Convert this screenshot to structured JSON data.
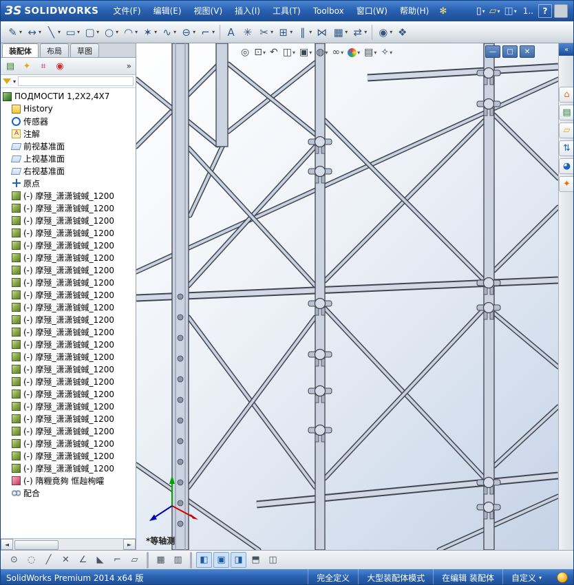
{
  "colors": {
    "titlebar_blue": "#2a62b2",
    "statusbar_blue": "#2a62b2",
    "toolbar_gray": "#dfe4ea",
    "pressed_blue": "#cde0f7",
    "scaffold_steel": "#ccd3e0",
    "viewport_bg_top": "#ffffff",
    "viewport_bg_bottom": "#c5d3e6"
  },
  "titlebar": {
    "logo_mark": "ЗS",
    "logo_text": "SOLIDWORKS",
    "menus": [
      {
        "label": "文件(F)"
      },
      {
        "label": "编辑(E)"
      },
      {
        "label": "视图(V)"
      },
      {
        "label": "插入(I)"
      },
      {
        "label": "工具(T)"
      },
      {
        "label": "Toolbox"
      },
      {
        "label": "窗口(W)"
      },
      {
        "label": "帮助(H)"
      }
    ],
    "sparkle": "✻",
    "quick_icons": [
      {
        "name": "new-document-icon",
        "g": "▯",
        "arrow": "▾"
      },
      {
        "name": "open-icon",
        "g": "▱",
        "arrow": "▾"
      },
      {
        "name": "save-icon",
        "g": "◫",
        "arrow": "▾"
      }
    ],
    "doc_title": "1..",
    "help_label": "?"
  },
  "toolbar": {
    "items": [
      {
        "name": "sketch-icon",
        "g": "✎",
        "arrow": "▾"
      },
      {
        "name": "smart-dimension-icon",
        "g": "↔",
        "arrow": "▾"
      },
      {
        "name": "line-icon",
        "g": "╲",
        "arrow": "▾"
      },
      {
        "name": "rectangle-icon",
        "g": "▭",
        "arrow": "▾"
      },
      {
        "name": "slot-icon",
        "g": "▢",
        "arrow": "▾"
      },
      {
        "name": "circle-icon",
        "g": "○",
        "arrow": "▾"
      },
      {
        "name": "arc-icon",
        "g": "◠",
        "arrow": "▾"
      },
      {
        "name": "polygon-icon",
        "g": "✶",
        "arrow": "▾"
      },
      {
        "name": "spline-icon",
        "g": "∿",
        "arrow": "▾"
      },
      {
        "name": "ellipse-icon",
        "g": "⊖",
        "arrow": "▾"
      },
      {
        "name": "fillet-icon",
        "g": "⌐",
        "arrow": "▾"
      },
      {
        "name": "separator",
        "kind": "sep"
      },
      {
        "name": "text-icon",
        "g": "A"
      },
      {
        "name": "point-icon",
        "g": "✳"
      },
      {
        "name": "trim-icon",
        "g": "✂",
        "arrow": "▾"
      },
      {
        "name": "convert-entities-icon",
        "g": "⊞",
        "arrow": "▾"
      },
      {
        "name": "offset-entities-icon",
        "g": "∥",
        "arrow": "▾"
      },
      {
        "name": "mirror-entities-icon",
        "g": "⋈"
      },
      {
        "name": "linear-pattern-icon",
        "g": "▦",
        "arrow": "▾"
      },
      {
        "name": "move-entities-icon",
        "g": "⇄",
        "arrow": "▾"
      },
      {
        "name": "separator",
        "kind": "sep"
      },
      {
        "name": "display-relations-icon",
        "g": "◉",
        "arrow": "▾"
      },
      {
        "name": "rapid-sketch-icon",
        "g": "❖"
      }
    ]
  },
  "panel": {
    "tabs": [
      {
        "label": "装配体",
        "active": "true"
      },
      {
        "label": "布局",
        "active": "false"
      },
      {
        "label": "草图",
        "active": "false"
      }
    ],
    "manager_icons": [
      {
        "name": "featuremanager-tab-icon",
        "g": "▤"
      },
      {
        "name": "propertymanager-tab-icon",
        "g": "✦"
      },
      {
        "name": "configurationmanager-tab-icon",
        "g": "⌗"
      },
      {
        "name": "displaymanager-tab-icon",
        "g": "◉"
      }
    ],
    "flyout": "»",
    "tree": {
      "items": [
        {
          "icon": "assembly-root-icon",
          "label": "ПОДМОСТИ 1,2X2,4X7",
          "ind": "0"
        },
        {
          "icon": "history-icon",
          "label": "History",
          "ind": "1"
        },
        {
          "icon": "sensors-icon",
          "label": "传感器",
          "ind": "1"
        },
        {
          "icon": "annotations-icon",
          "label": "注解",
          "ind": "1"
        },
        {
          "icon": "plane-icon",
          "label": "前视基准面",
          "ind": "1"
        },
        {
          "icon": "plane-icon",
          "label": "上视基准面",
          "ind": "1"
        },
        {
          "icon": "plane-icon",
          "label": "右视基准面",
          "ind": "1"
        },
        {
          "icon": "origin-icon",
          "label": "原点",
          "ind": "1"
        },
        {
          "icon": "component-icon",
          "label": "(-) 摩殛_潇潇铖蜮_1200",
          "ind": "1"
        },
        {
          "icon": "component-icon",
          "label": "(-) 摩殛_潇潇铖蜮_1200",
          "ind": "1"
        },
        {
          "icon": "component-icon",
          "label": "(-) 摩殛_潇潇铖蜮_1200",
          "ind": "1"
        },
        {
          "icon": "component-icon",
          "label": "(-) 摩殛_潇潇铖蜮_1200",
          "ind": "1"
        },
        {
          "icon": "component-icon",
          "label": "(-) 摩殛_潇潇铖蜮_1200",
          "ind": "1"
        },
        {
          "icon": "component-icon",
          "label": "(-) 摩殛_潇潇铖蜮_1200",
          "ind": "1"
        },
        {
          "icon": "component-icon",
          "label": "(-) 摩殛_潇潇铖蜮_1200",
          "ind": "1"
        },
        {
          "icon": "component-icon",
          "label": "(-) 摩殛_潇潇铖蜮_1200",
          "ind": "1"
        },
        {
          "icon": "component-icon",
          "label": "(-) 摩殛_潇潇铖蜮_1200",
          "ind": "1"
        },
        {
          "icon": "component-icon",
          "label": "(-) 摩殛_潇潇铖蜮_1200",
          "ind": "1"
        },
        {
          "icon": "component-icon",
          "label": "(-) 摩殛_潇潇铖蜮_1200",
          "ind": "1"
        },
        {
          "icon": "component-icon",
          "label": "(-) 摩殛_潇潇铖蜮_1200",
          "ind": "1"
        },
        {
          "icon": "component-icon",
          "label": "(-) 摩殛_潇潇铖蜮_1200",
          "ind": "1"
        },
        {
          "icon": "component-icon",
          "label": "(-) 摩殛_潇潇铖蜮_1200",
          "ind": "1"
        },
        {
          "icon": "component-icon",
          "label": "(-) 摩殛_潇潇铖蜮_1200",
          "ind": "1"
        },
        {
          "icon": "component-icon",
          "label": "(-) 摩殛_潇潇铖蜮_1200",
          "ind": "1"
        },
        {
          "icon": "component-icon",
          "label": "(-) 摩殛_潇潇铖蜮_1200",
          "ind": "1"
        },
        {
          "icon": "component-icon",
          "label": "(-) 摩殛_潇潇铖蜮_1200",
          "ind": "1"
        },
        {
          "icon": "component-icon",
          "label": "(-) 摩殛_潇潇铖蜮_1200",
          "ind": "1"
        },
        {
          "icon": "component-icon",
          "label": "(-) 摩殛_潇潇铖蜮_1200",
          "ind": "1"
        },
        {
          "icon": "component-icon",
          "label": "(-) 摩殛_潇潇铖蜮_1200",
          "ind": "1"
        },
        {
          "icon": "component-icon",
          "label": "(-) 摩殛_潇潇铖蜮_1200",
          "ind": "1"
        },
        {
          "icon": "component-icon",
          "label": "(-) 摩殛_潇潇铖蜮_1200",
          "ind": "1"
        },
        {
          "icon": "component-red-icon",
          "label": "(-) 隋糎竟夠 恇赸栒曤",
          "ind": "1"
        },
        {
          "icon": "mates-icon",
          "label": "配合",
          "ind": "1"
        }
      ]
    }
  },
  "viewport": {
    "view_label": "*等轴测",
    "hud": [
      {
        "name": "zoom-fit-icon",
        "g": "◎"
      },
      {
        "name": "zoom-area-icon",
        "g": "⊡",
        "arrow": "▾"
      },
      {
        "name": "previous-view-icon",
        "g": "↶"
      },
      {
        "name": "section-view-icon",
        "g": "◫",
        "arrow": "▾"
      },
      {
        "name": "view-orientation-icon",
        "g": "▣",
        "arrow": "▾"
      },
      {
        "name": "display-style-icon",
        "g": "◍",
        "arrow": "▾"
      },
      {
        "name": "hide-show-items-icon",
        "g": "∞",
        "arrow": "▾"
      },
      {
        "name": "appearance-icon",
        "g": "●",
        "arrow": "▾"
      },
      {
        "name": "scene-icon",
        "g": "▤",
        "arrow": "▾"
      },
      {
        "name": "view-settings-icon",
        "g": "✧",
        "arrow": "▾"
      }
    ],
    "doc_controls": [
      {
        "name": "minimize-doc-icon",
        "g": "—"
      },
      {
        "name": "restore-doc-icon",
        "g": "□"
      },
      {
        "name": "close-doc-icon",
        "g": "✕"
      }
    ]
  },
  "rightbar": {
    "collapse": "«",
    "icons": [
      {
        "name": "home-icon",
        "g": "⌂"
      },
      {
        "name": "design-library-icon",
        "g": "▤"
      },
      {
        "name": "file-explorer-icon",
        "g": "▱"
      },
      {
        "name": "view-palette-icon",
        "g": "⇅"
      },
      {
        "name": "appearances-scenes-icon",
        "g": "◕"
      },
      {
        "name": "custom-properties-icon",
        "g": "✦"
      }
    ]
  },
  "bottombar": {
    "items": [
      {
        "name": "reorient-icon",
        "g": "⊙"
      },
      {
        "name": "circle-snap-icon",
        "g": "◌"
      },
      {
        "name": "line-snap-icon",
        "g": "╱"
      },
      {
        "name": "delete-icon",
        "g": "✕"
      },
      {
        "name": "angle-snap-icon",
        "g": "∠"
      },
      {
        "name": "triangle-snap-icon",
        "g": "◣"
      },
      {
        "name": "corner-snap-icon",
        "g": "⌐"
      },
      {
        "name": "plane-view-icon",
        "g": "▱"
      },
      {
        "name": "separator",
        "kind": "sep"
      },
      {
        "name": "grid-icon",
        "g": "▦"
      },
      {
        "name": "hatch-icon",
        "g": "▥"
      },
      {
        "name": "separator",
        "kind": "sep"
      },
      {
        "name": "pane-left-icon",
        "g": "◧",
        "pressed": "true"
      },
      {
        "name": "pane-full-icon",
        "g": "▣",
        "pressed": "true"
      },
      {
        "name": "pane-right-icon",
        "g": "◨",
        "pressed": "true"
      },
      {
        "name": "split-horizontal-icon",
        "g": "⬒"
      },
      {
        "name": "split-vertical-icon",
        "g": "◫"
      }
    ]
  },
  "statusbar": {
    "product": "SolidWorks Premium 2014 x64 版",
    "defined": "完全定义",
    "mode": "大型装配体模式",
    "editing": "在编辑 装配体",
    "custom": "自定义"
  }
}
